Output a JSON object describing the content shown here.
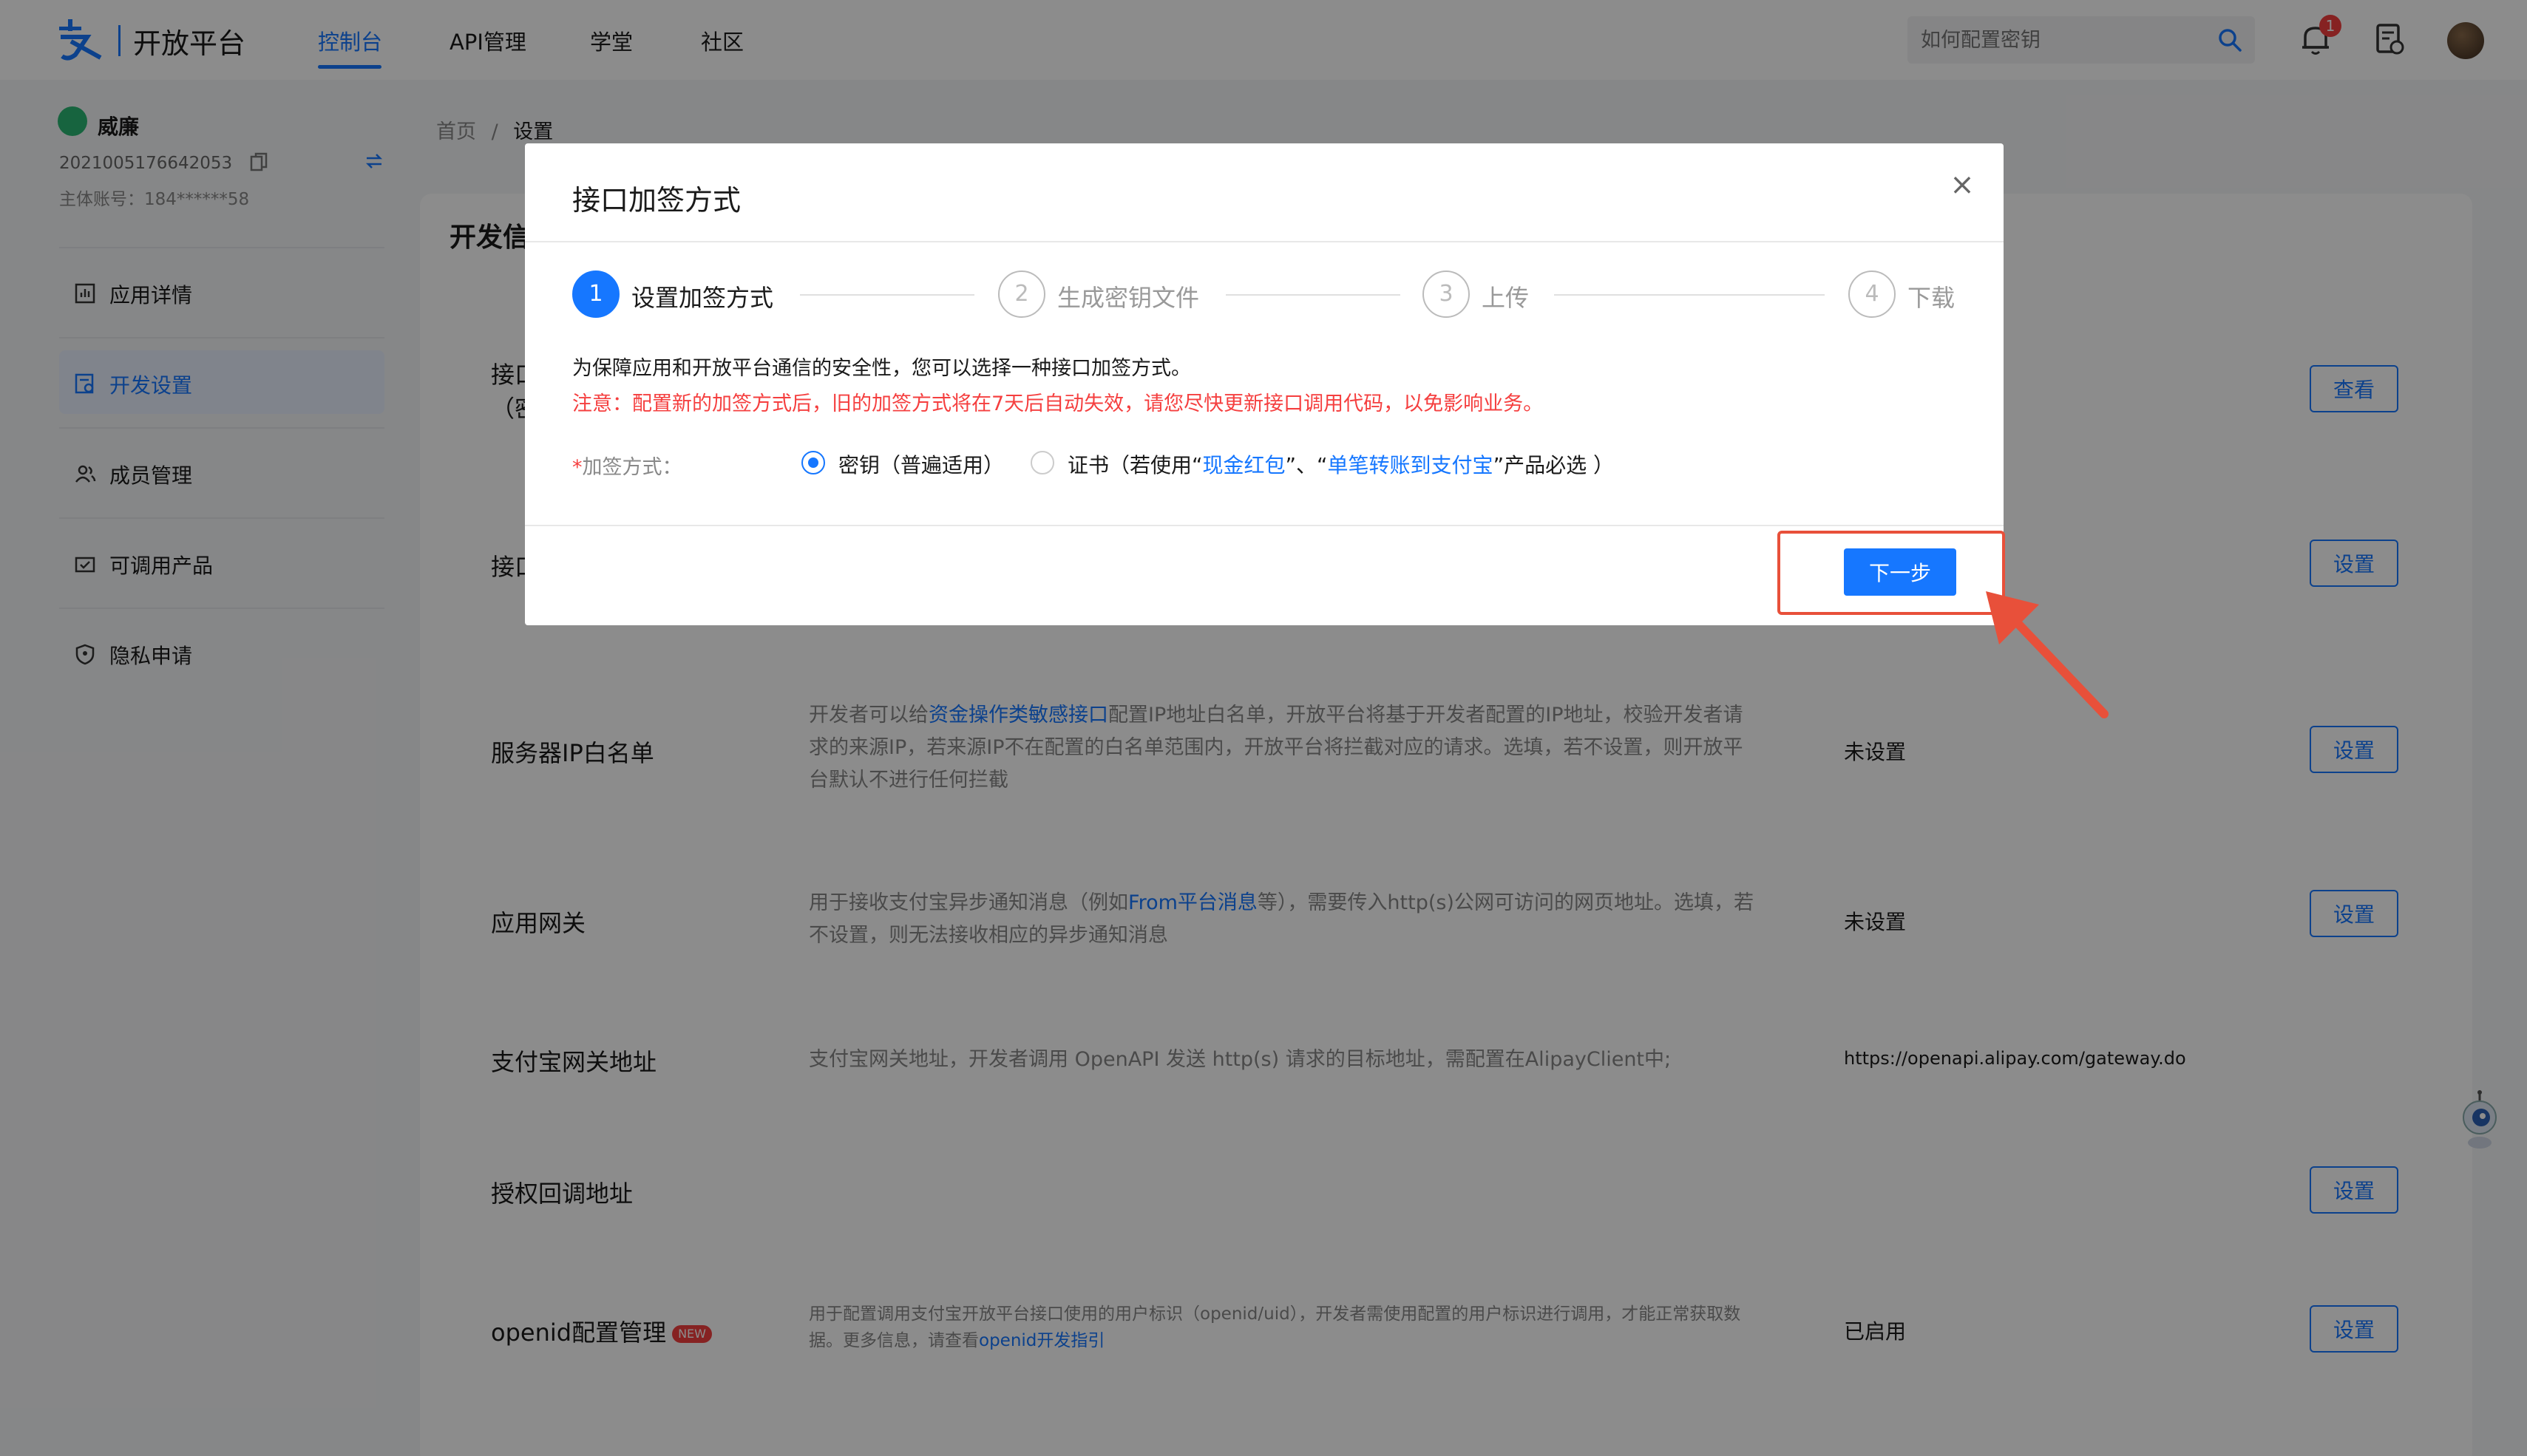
{
  "header": {
    "logo_text": "开放平台",
    "nav": [
      "控制台",
      "API管理",
      "学堂",
      "社区"
    ],
    "active_nav": "控制台",
    "search_placeholder": "如何配置密钥",
    "notification_count": "1"
  },
  "sidebar": {
    "user_name": "威廉",
    "app_id": "2021005176642053",
    "account_label": "主体账号：",
    "account_value": "184******58",
    "items": [
      {
        "label": "应用详情",
        "icon": "chart-icon"
      },
      {
        "label": "开发设置",
        "icon": "settings-doc-icon",
        "active": true
      },
      {
        "label": "成员管理",
        "icon": "users-icon"
      },
      {
        "label": "可调用产品",
        "icon": "product-icon"
      },
      {
        "label": "隐私申请",
        "icon": "shield-icon"
      }
    ]
  },
  "breadcrumb": {
    "home": "首页",
    "separator": "/",
    "current": "设置"
  },
  "main": {
    "card_title": "开发信",
    "rows": [
      {
        "title": "接口",
        "title2": "（密",
        "desc": "",
        "value": "",
        "button": "查看"
      },
      {
        "title": "接口",
        "desc": "",
        "value": "",
        "button": "设置"
      },
      {
        "title": "服务器IP白名单",
        "desc_pre": "开发者可以给",
        "desc_link": "资金操作类敏感接口",
        "desc_post": "配置IP地址白名单，开放平台将基于开发者配置的IP地址，校验开发者请求的来源IP，若来源IP不在配置的白名单范围内，开放平台将拦截对应的请求。选填，若不设置，则开放平台默认不进行任何拦截",
        "value": "未设置",
        "button": "设置"
      },
      {
        "title": "应用网关",
        "desc_pre": "用于接收支付宝异步通知消息（例如",
        "desc_link": "From平台消息",
        "desc_post": "等），需要传入http(s)公网可访问的网页地址。选填，若不设置，则无法接收相应的异步通知消息",
        "value": "未设置",
        "button": "设置"
      },
      {
        "title": "支付宝网关地址",
        "desc": "支付宝网关地址，开发者调用 OpenAPI 发送 http(s) 请求的目标地址，需配置在AlipayClient中;",
        "value": "https://openapi.alipay.com/gateway.do",
        "button": ""
      },
      {
        "title": "授权回调地址",
        "desc": "",
        "value": "",
        "button": "设置"
      },
      {
        "title": "openid配置管理",
        "badge": "NEW",
        "desc_pre": "用于配置调用支付宝开放平台接口使用的用户标识（openid/uid），开发者需使用配置的用户标识进行调用，才能正常获取数据。更多信息，请查看",
        "desc_link": "openid开发指引",
        "desc_post": "",
        "value": "已启用",
        "button": "设置"
      }
    ]
  },
  "modal": {
    "title": "接口加签方式",
    "steps": [
      {
        "num": "1",
        "label": "设置加签方式",
        "active": true
      },
      {
        "num": "2",
        "label": "生成密钥文件",
        "active": false
      },
      {
        "num": "3",
        "label": "上传",
        "active": false
      },
      {
        "num": "4",
        "label": "下载",
        "active": false
      }
    ],
    "info": "为保障应用和开放平台通信的安全性，您可以选择一种接口加签方式。",
    "warning": "注意：配置新的加签方式后，旧的加签方式将在7天后自动失效，请您尽快更新接口调用代码，以免影响业务。",
    "form_required": "*",
    "form_label": "加签方式：",
    "option_key": "密钥（普遍适用）",
    "option_cert_pre": "证书（若使用“",
    "option_cert_link1": "现金红包",
    "option_cert_mid": "”、“",
    "option_cert_link2": "单笔转账到支付宝",
    "option_cert_post": "”产品必选 ）",
    "selected_option": "密钥",
    "next_button": "下一步"
  },
  "colors": {
    "primary": "#1677ff",
    "warning": "#f53f3f",
    "annotation": "#e8503a"
  }
}
